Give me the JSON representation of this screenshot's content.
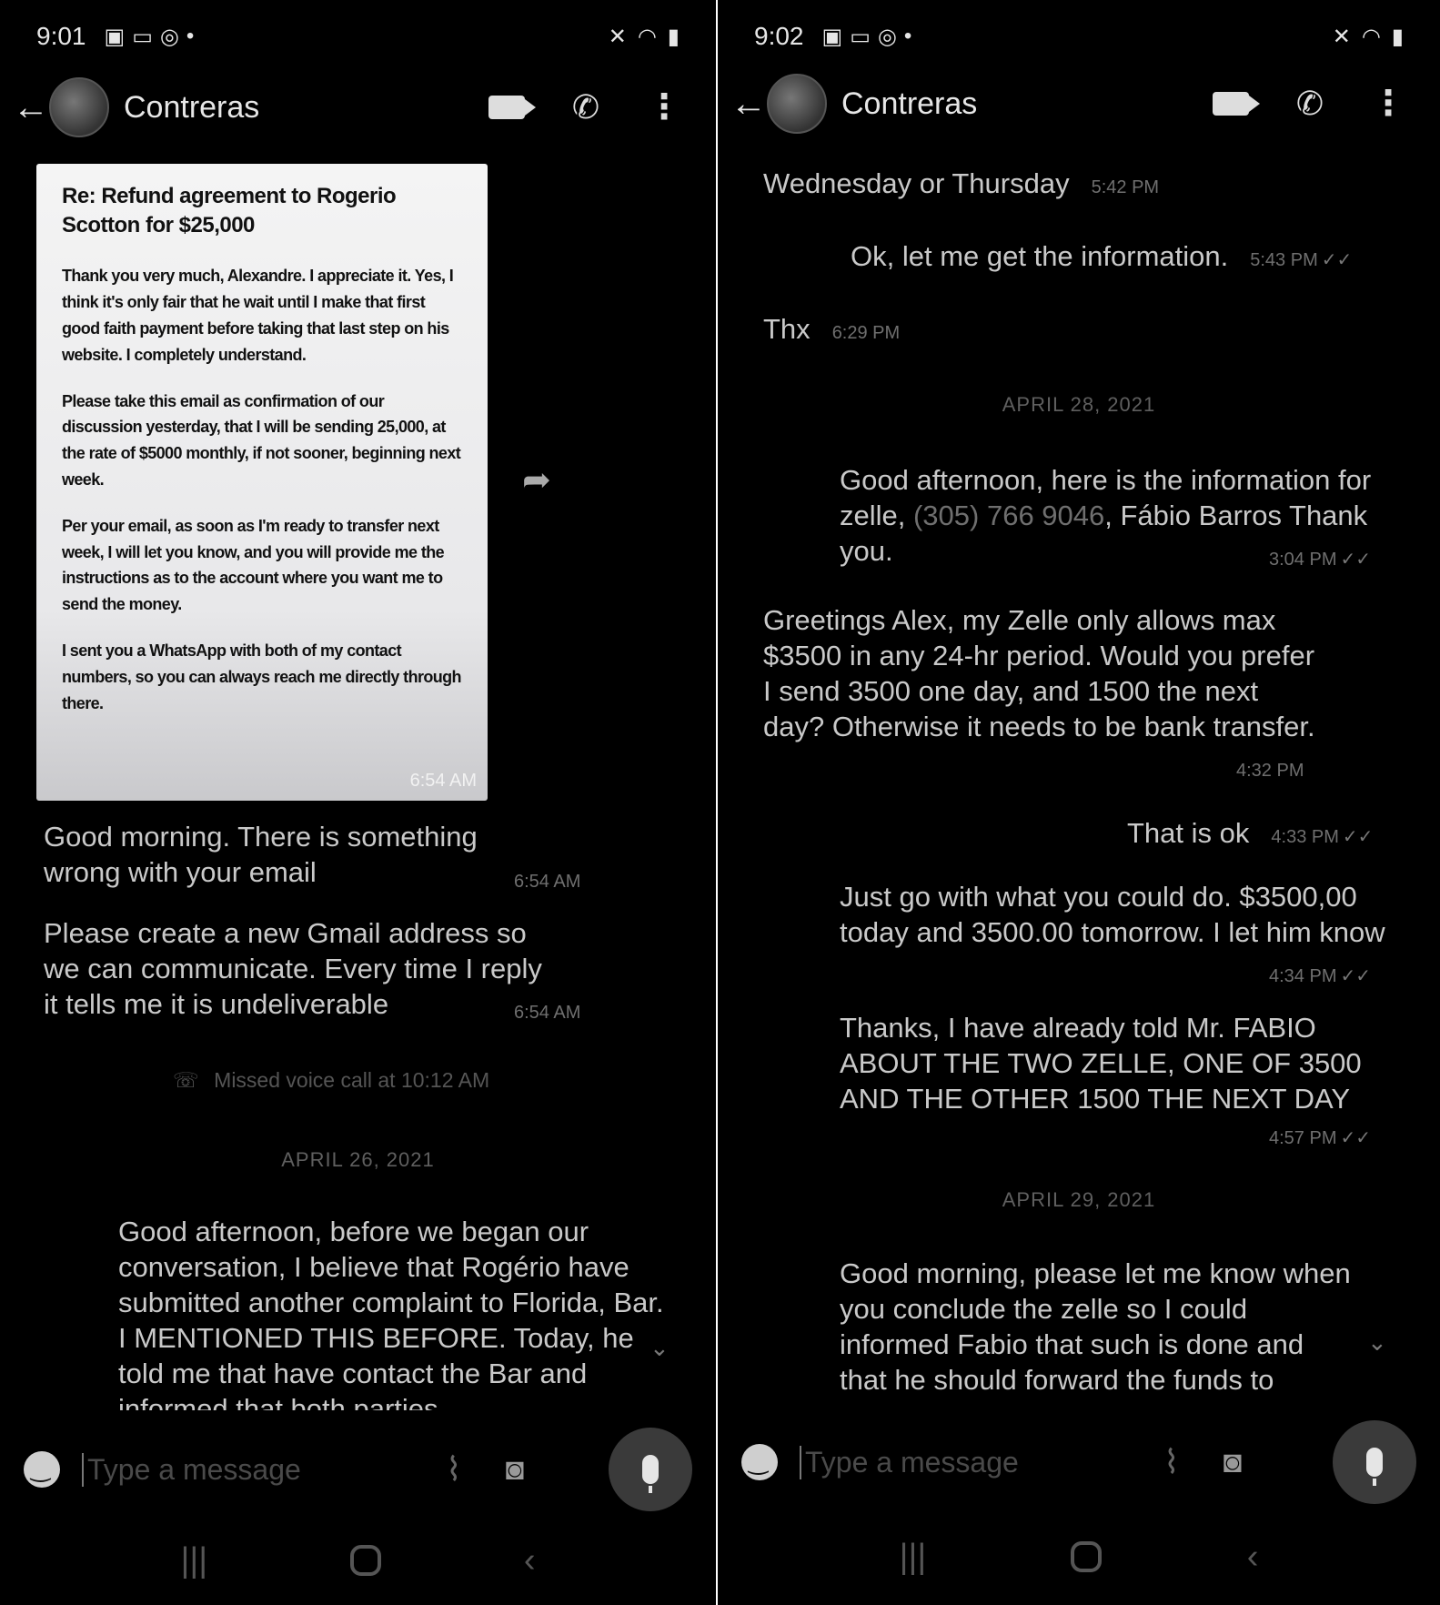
{
  "left": {
    "status": {
      "time": "9:01",
      "dot": "•"
    },
    "contact": "Contreras",
    "email": {
      "title": "Re: Refund agreement to Rogerio Scotton for $25,000",
      "paragraphs": [
        "Thank you very much, Alexandre. I appreciate it. Yes, I think it's only fair that he wait until I make that first good faith payment before taking that last step on his website. I completely understand.",
        "Please take this email as confirmation of our discussion yesterday, that I will be sending 25,000, at the rate of $5000 monthly, if not sooner, beginning next week.",
        "Per your email, as soon as I'm ready to transfer next week, I will let you know, and you will provide me the instructions as to the account where you want me to send the money.",
        "I sent you a WhatsApp with both of my contact numbers, so you can always reach me directly through there."
      ],
      "time": "6:54 AM"
    },
    "messages": [
      {
        "text": "Good morning. There is something wrong with your email",
        "time": "6:54 AM"
      },
      {
        "text": "Please create a new Gmail address so we can communicate. Every time I reply it tells me it is undeliverable",
        "time": "6:54 AM"
      }
    ],
    "missed_call": "Missed voice call at 10:12 AM",
    "date_sep": "APRIL 26, 2021",
    "long_message": "Good afternoon,  before we began our conversation, I believe that Rogério  have submitted another complaint to Florida, Bar. I MENTIONED THIS BEFORE. Today, he told me that have contact the Bar and informed that both parties",
    "composer_placeholder": "Type a message"
  },
  "right": {
    "status": {
      "time": "9:02",
      "dot": "•"
    },
    "contact": "Contreras",
    "messages": [
      {
        "text": "Wednesday or Thursday",
        "time": "5:42 PM"
      },
      {
        "text": "Ok, let me get the information.",
        "time": "5:43 PM",
        "tick": "✓✓"
      },
      {
        "text": "Thx",
        "time": "6:29 PM"
      }
    ],
    "date_sep_1": "APRIL 28, 2021",
    "zelle_msg": {
      "before": "Good afternoon,  here is the information for zelle, ",
      "phone": "(305) 766 9046",
      "after": ", Fábio Barros Thank you.",
      "time": "3:04 PM",
      "tick": "✓✓"
    },
    "greetings_msg": {
      "text": "Greetings Alex, my Zelle only allows max $3500 in any 24-hr period.  Would you prefer I send 3500 one day, and 1500 the next day?  Otherwise it needs to be bank transfer.",
      "time": "4:32 PM"
    },
    "ok_msg": {
      "text": "That is ok",
      "time": "4:33 PM",
      "tick": "✓✓"
    },
    "just_go_msg": {
      "text": "Just go with what you could do. $3500,00 today and 3500.00 tomorrow. I let him know",
      "time": "4:34 PM",
      "tick": "✓✓"
    },
    "thanks_msg": {
      "text": "Thanks, I have already told Mr. FABIO ABOUT THE TWO ZELLE, ONE OF 3500 AND THE OTHER 1500 THE NEXT DAY",
      "time": "4:57 PM",
      "tick": "✓✓"
    },
    "date_sep_2": "APRIL 29, 2021",
    "morning_msg": "Good morning,  please let me know when you conclude the zelle so I could informed Fabio that such is done and that he should forward the funds to",
    "composer_placeholder": "Type a message"
  }
}
